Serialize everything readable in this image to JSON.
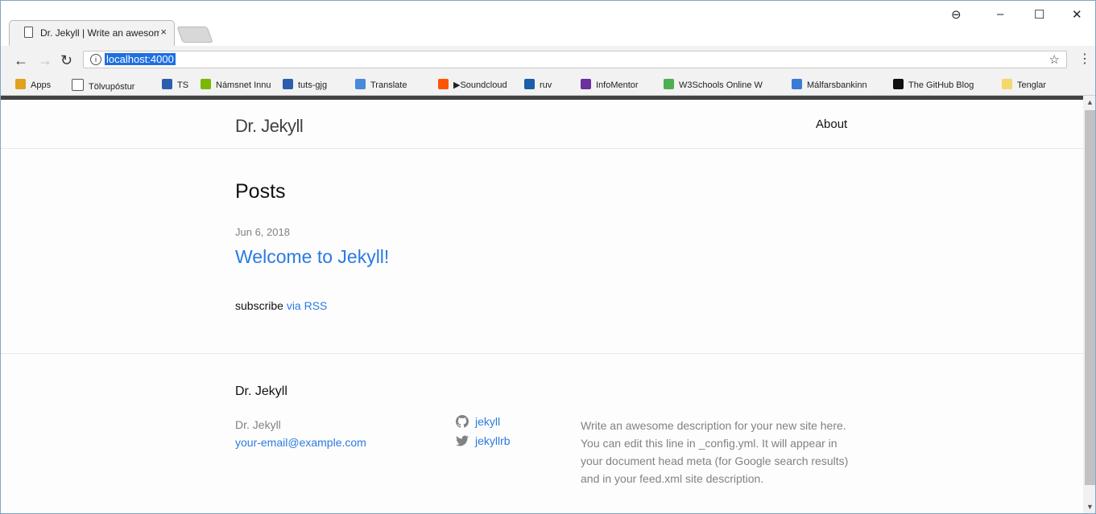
{
  "browser": {
    "tab_title": "Dr. Jekyll | Write an awesome",
    "tab_close": "×",
    "url": "localhost:4000",
    "window_controls": {
      "account": "⊖",
      "minimize": "–",
      "maximize": "☐",
      "close": "✕"
    }
  },
  "bookmarks": [
    {
      "label": "Apps",
      "icon": "apps-grid-icon",
      "color": "#e0a020"
    },
    {
      "label": "Tölvupóstur",
      "icon": "page-icon",
      "color": "#ffffff"
    },
    {
      "label": "TS",
      "icon": "ts-icon",
      "color": "#2b5fae"
    },
    {
      "label": "Námsnet Innu",
      "icon": "innu-icon",
      "color": "#7ab800"
    },
    {
      "label": "tuts-gjg",
      "icon": "tuts-icon",
      "color": "#2b5fae"
    },
    {
      "label": "Translate",
      "icon": "translate-icon",
      "color": "#4a89dc"
    },
    {
      "label": "▶Soundcloud",
      "icon": "soundcloud-icon",
      "color": "#ff5500"
    },
    {
      "label": "ruv",
      "icon": "ruv-icon",
      "color": "#1a5fa8"
    },
    {
      "label": "InfoMentor",
      "icon": "infomentor-icon",
      "color": "#6b2fa0"
    },
    {
      "label": "W3Schools Online W",
      "icon": "w3schools-icon",
      "color": "#4caf50"
    },
    {
      "label": "Málfarsbankinn",
      "icon": "magnifier-icon",
      "color": "#3a7bd5"
    },
    {
      "label": "The GitHub Blog",
      "icon": "github-icon",
      "color": "#111111"
    },
    {
      "label": "Tenglar",
      "icon": "folder-icon",
      "color": "#f5d76e"
    }
  ],
  "site": {
    "title": "Dr. Jekyll",
    "nav_about": "About"
  },
  "main": {
    "heading": "Posts",
    "posts": [
      {
        "date": "Jun 6, 2018",
        "title": "Welcome to Jekyll!"
      }
    ],
    "subscribe_text": "subscribe",
    "subscribe_link": "via RSS"
  },
  "footer": {
    "title": "Dr. Jekyll",
    "name": "Dr. Jekyll",
    "email": "your-email@example.com",
    "github": "jekyll",
    "twitter": "jekyllrb",
    "description": "Write an awesome description for your new site here. You can edit this line in _config.yml. It will appear in your document head meta (for Google search results) and in your feed.xml site description."
  },
  "colors": {
    "link": "#2a7ae2",
    "muted": "#828282",
    "selection": "#1f6fe0"
  }
}
